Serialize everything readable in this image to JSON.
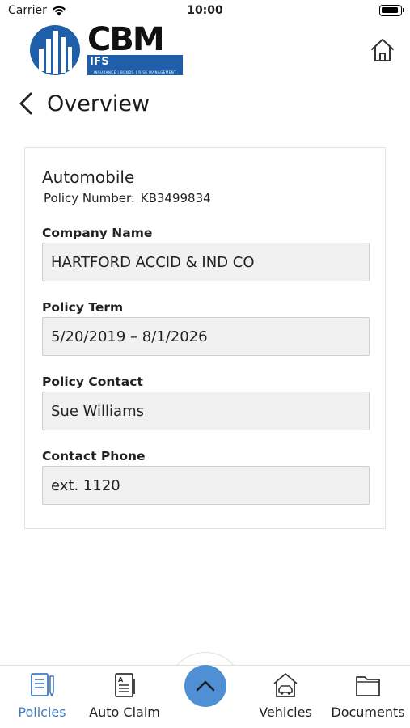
{
  "status_bar": {
    "carrier": "Carrier",
    "time": "10:00"
  },
  "header": {
    "logo": {
      "brand": "CBM",
      "subbrand": "IFS INSURANCE",
      "tagline": "INSURANCE | BONDS | RISK MANAGEMENT"
    },
    "home_icon": "home-icon"
  },
  "page": {
    "title": "Overview",
    "back_icon": "chevron-left-icon"
  },
  "policy": {
    "type": "Automobile",
    "number_label": "Policy Number:",
    "number": "KB3499834",
    "fields": [
      {
        "label": "Company Name",
        "value": "HARTFORD ACCID & IND CO"
      },
      {
        "label": "Policy Term",
        "value": "5/20/2019 – 8/1/2026"
      },
      {
        "label": "Policy Contact",
        "value": "Sue Williams"
      },
      {
        "label": "Contact Phone",
        "value": "ext. 1120"
      }
    ]
  },
  "tabbar": {
    "tabs": [
      {
        "label": "Policies",
        "icon": "document-pen-icon",
        "active": true
      },
      {
        "label": "Auto Claim",
        "icon": "claim-form-icon",
        "active": false
      },
      {
        "label": "Vehicles",
        "icon": "car-house-icon",
        "active": false
      },
      {
        "label": "Documents",
        "icon": "folder-icon",
        "active": false
      }
    ],
    "center_button_icon": "chevron-up-icon"
  },
  "colors": {
    "accent": "#4f8fd3",
    "active_tab": "#3f7cc0",
    "brand_blue": "#1f5ea8",
    "field_bg": "#f1f1f1"
  }
}
